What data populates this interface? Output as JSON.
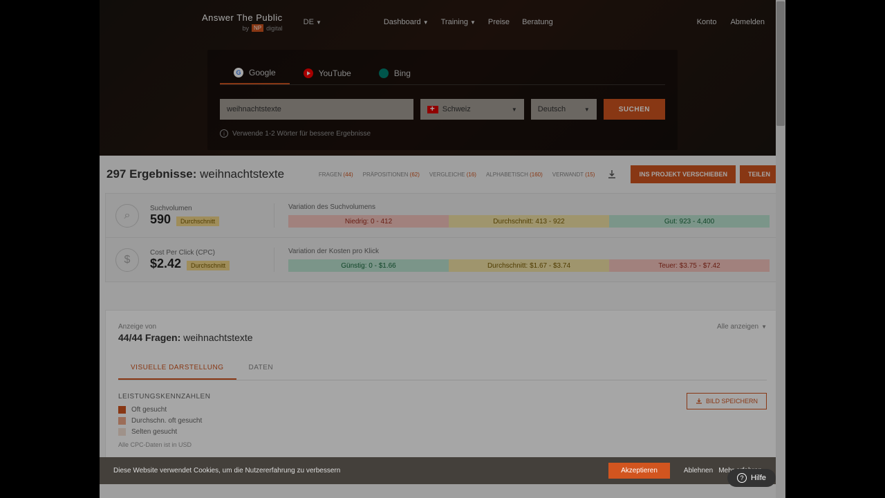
{
  "brand": {
    "name": "Answer The Public",
    "by": "by",
    "np": "NP",
    "digital": "digital"
  },
  "langSel": "DE",
  "nav": {
    "dashboard": "Dashboard",
    "training": "Training",
    "preise": "Preise",
    "beratung": "Beratung",
    "konto": "Konto",
    "abmelden": "Abmelden"
  },
  "engines": {
    "google": "Google",
    "youtube": "YouTube",
    "bing": "Bing"
  },
  "search": {
    "value": "weihnachtstexte",
    "country": "Schweiz",
    "language": "Deutsch",
    "button": "SUCHEN",
    "hint": "Verwende 1-2 Wörter für bessere Ergebnisse"
  },
  "results": {
    "count": "297 Ergebnisse:",
    "term": "weihnachtstexte"
  },
  "filters": {
    "fragen": {
      "label": "FRAGEN",
      "count": "(44)"
    },
    "praep": {
      "label": "PRÄPOSITIONEN",
      "count": "(62)"
    },
    "vergleiche": {
      "label": "VERGLEICHE",
      "count": "(16)"
    },
    "alpha": {
      "label": "ALPHABETISCH",
      "count": "(160)"
    },
    "verwandt": {
      "label": "VERWANDT",
      "count": "(15)"
    }
  },
  "actions": {
    "project": "INS PROJEKT VERSCHIEBEN",
    "teilen": "TEILEN"
  },
  "sv": {
    "label": "Suchvolumen",
    "value": "590",
    "badge": "Durchschnitt",
    "varLabel": "Variation des Suchvolumens",
    "low": "Niedrig: 0 - 412",
    "mid": "Durchschnitt: 413 - 922",
    "hi": "Gut: 923 - 4,400"
  },
  "cpc": {
    "label": "Cost Per Click (CPC)",
    "value": "$2.42",
    "badge": "Durchschnitt",
    "varLabel": "Variation der Kosten pro Klick",
    "low": "Günstig: 0 - $1.66",
    "mid": "Durchschnitt: $1.67 - $3.74",
    "hi": "Teuer: $3.75 - $7.42"
  },
  "questions": {
    "sub": "Anzeige von",
    "main_count": "44/44 Fragen:",
    "main_term": "weihnachtstexte",
    "showAll": "Alle anzeigen",
    "tabVisual": "VISUELLE DARSTELLUNG",
    "tabData": "DATEN",
    "legendTitle": "LEISTUNGSKENNZAHLEN",
    "l1": "Oft gesucht",
    "l2": "Durchschn. oft gesucht",
    "l3": "Selten gesucht",
    "note": "Alle CPC-Daten ist in USD",
    "saveBtn": "BILD SPEICHERN"
  },
  "cookie": {
    "text": "Diese Website verwendet Cookies, um die Nutzererfahrung zu verbessern",
    "accept": "Akzeptieren",
    "decline": "Ablehnen",
    "more": "Mehr erfahren"
  },
  "help": "Hilfe"
}
